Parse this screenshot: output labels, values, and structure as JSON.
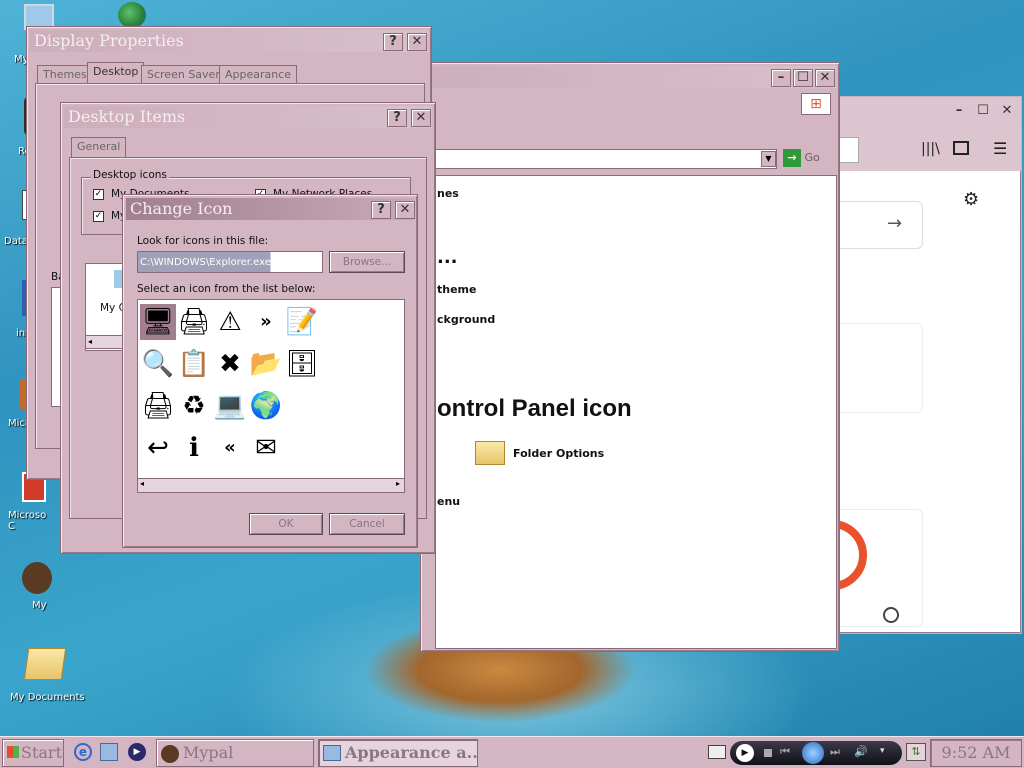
{
  "desktop": {
    "icons": [
      {
        "label": "My",
        "icon": "computer-icon"
      },
      {
        "label": "Re",
        "icon": "recycle-bin-icon"
      },
      {
        "label": "Data",
        "icon": "database-icon"
      },
      {
        "label": "ins",
        "icon": "installer-icon"
      },
      {
        "label": "Micro",
        "icon": "app-icon"
      },
      {
        "label": "Microso C",
        "icon": "app-shortcut-icon"
      },
      {
        "label": "My",
        "icon": "monkey-icon"
      },
      {
        "label": "My Documents",
        "icon": "folder-icon"
      }
    ]
  },
  "display_properties": {
    "title": "Display Properties",
    "tabs": [
      "Themes",
      "Desktop",
      "Screen Saver",
      "Appearance"
    ],
    "fragment_b": "Ba",
    "fragment_myc": "My C"
  },
  "control_panel": {
    "go_label": "Go",
    "fragments": [
      "nes",
      "...",
      "theme",
      "ckground",
      "ontrol Panel icon",
      "Folder Options",
      "enu"
    ]
  },
  "desktop_items": {
    "title": "Desktop Items",
    "tab": "General",
    "group_label": "Desktop icons",
    "checkboxes": [
      {
        "label": "My Documents",
        "checked": true
      },
      {
        "label": "My Network Places",
        "checked": true
      },
      {
        "label": "My",
        "checked": true
      }
    ]
  },
  "change_icon": {
    "title": "Change Icon",
    "file_label": "Look for icons in this file:",
    "file_value": "C:\\WINDOWS\\Explorer.exe",
    "browse_label": "Browse...",
    "list_label": "Select an icon from the list below:",
    "ok_label": "OK",
    "cancel_label": "Cancel",
    "icons": [
      [
        "🖥",
        "🖨",
        "⚠",
        "»",
        "📝"
      ],
      [
        "🔍",
        "📋",
        "✖",
        "📂",
        "🗄"
      ],
      [
        "🖨",
        "♻",
        "💻",
        "🌍",
        ""
      ],
      [
        "↩",
        "ℹ",
        "«",
        "✉",
        ""
      ]
    ]
  },
  "taskbar": {
    "start_label": "Start",
    "task1": "Mypal",
    "task2": "Appearance a...",
    "clock": "9:52 AM"
  },
  "colors": {
    "accent": "#d4b5c2",
    "title_active": "#a17f8e",
    "desktop_water": "#2f93bf"
  }
}
